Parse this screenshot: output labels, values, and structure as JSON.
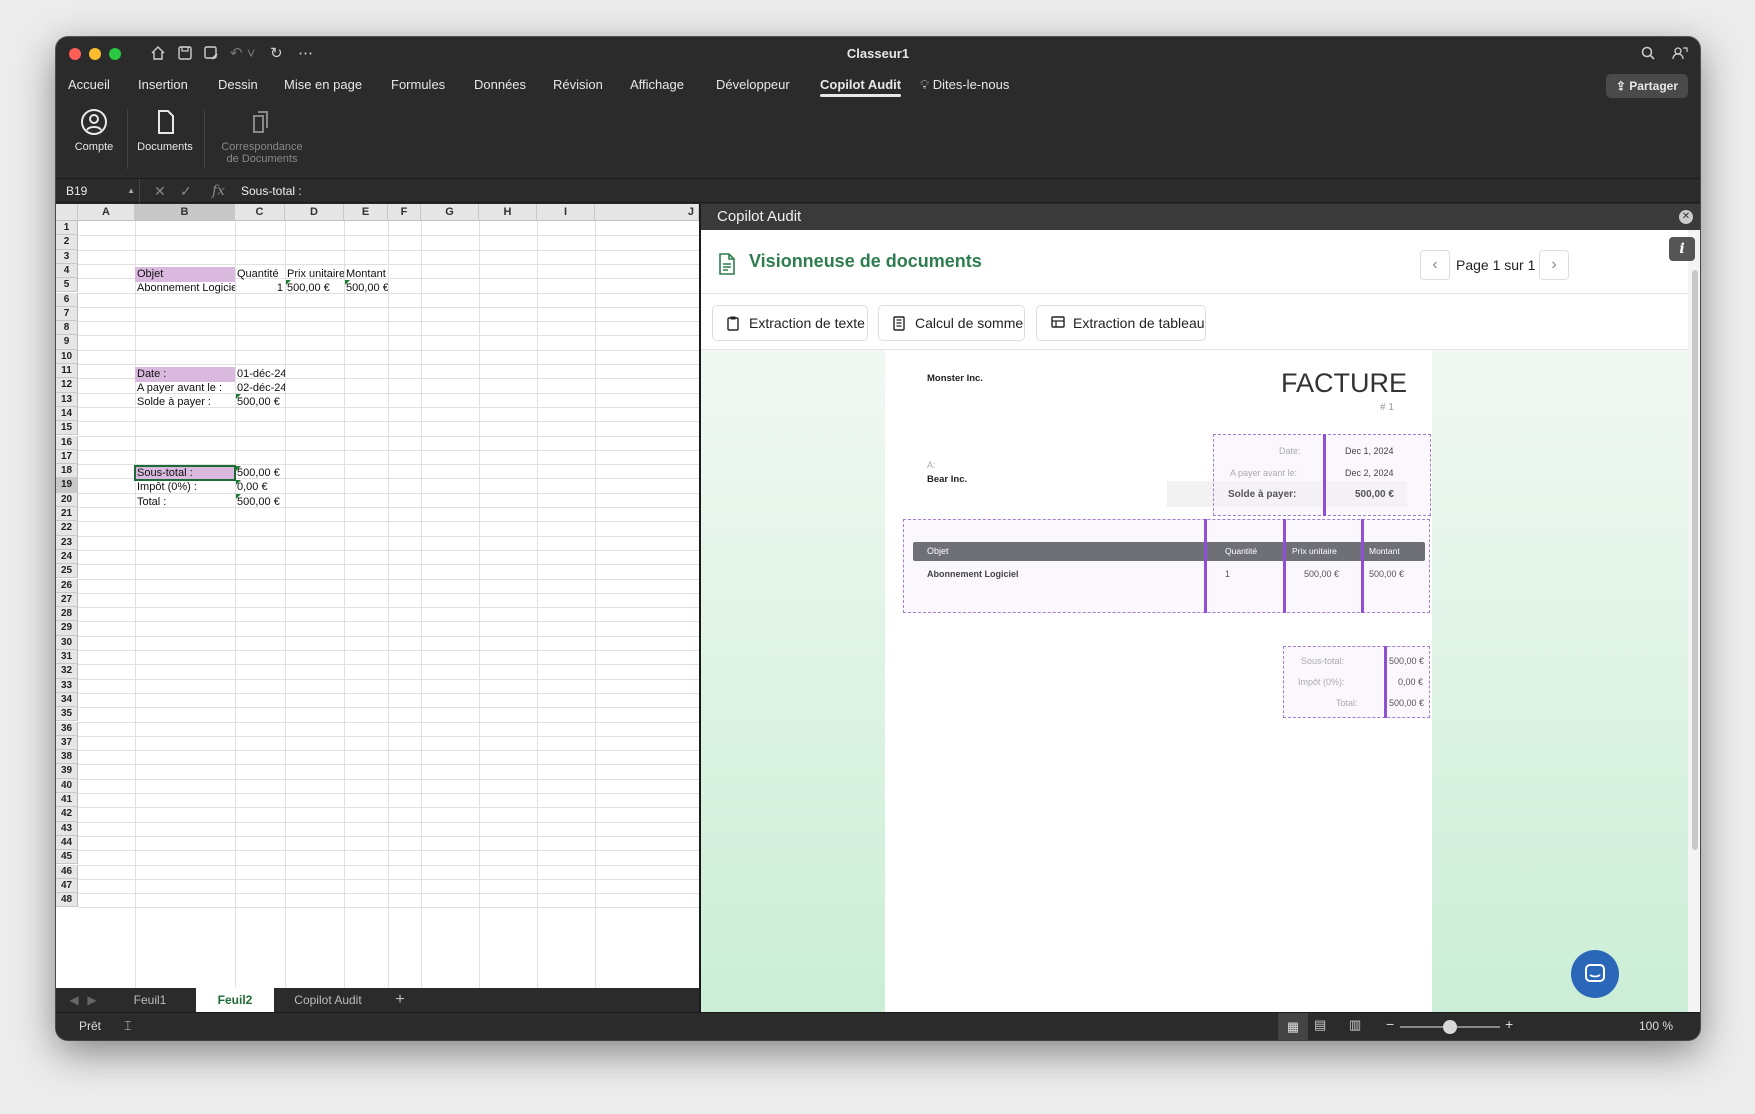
{
  "window": {
    "title": "Classeur1"
  },
  "menu_tabs": [
    "Accueil",
    "Insertion",
    "Dessin",
    "Mise en page",
    "Formules",
    "Données",
    "Révision",
    "Affichage",
    "Développeur",
    "Copilot Audit"
  ],
  "active_tab": "Copilot Audit",
  "tell_me": "Dites-le-nous",
  "share_label": "Partager",
  "ribbon": {
    "compte": "Compte",
    "documents": "Documents",
    "correspondance_l1": "Correspondance",
    "correspondance_l2": "de Documents"
  },
  "formula_bar": {
    "cell_ref": "B19",
    "fx": "fx",
    "content": "Sous-total :"
  },
  "columns": [
    "A",
    "B",
    "C",
    "D",
    "E",
    "F",
    "G",
    "H",
    "I",
    "J"
  ],
  "cells": {
    "b5": "Objet",
    "c5": "Quantité",
    "d5": "Prix unitaire",
    "e5": "Montant",
    "b6": "Abonnement Logiciel",
    "c6": "1",
    "d6": "500,00 €",
    "e6": "500,00 €",
    "b12": "Date :",
    "c12": "01-déc-24",
    "b13": "A payer avant le :",
    "c13": "02-déc-24",
    "b14": "Solde à payer :",
    "c14": "500,00 €",
    "b19": "Sous-total :",
    "c19": "500,00 €",
    "b20": "Impôt (0%) :",
    "c20": "0,00 €",
    "b21": "Total :",
    "c21": "500,00 €"
  },
  "sheet_tabs": [
    "Feuil1",
    "Feuil2",
    "Copilot Audit"
  ],
  "active_sheet": "Feuil2",
  "status": {
    "ready": "Prêt",
    "zoom": "100 %"
  },
  "pane": {
    "title": "Copilot Audit"
  },
  "viewer": {
    "title": "Visionneuse de documents",
    "page": "Page 1 sur 1",
    "tools": [
      "Extraction de texte",
      "Calcul de somme",
      "Extraction de tableau"
    ]
  },
  "invoice": {
    "company": "Monster Inc.",
    "heading": "FACTURE",
    "number": "# 1",
    "to_label": "A:",
    "to_name": "Bear Inc.",
    "date_label": "Date:",
    "date_value": "Dec 1, 2024",
    "due_label": "A payer avant le:",
    "due_value": "Dec 2, 2024",
    "balance_label": "Solde à payer:",
    "balance_value": "500,00 €",
    "table_headers": [
      "Objet",
      "Quantité",
      "Prix unitaire",
      "Montant"
    ],
    "row": [
      "Abonnement Logiciel",
      "1",
      "500,00 €",
      "500,00 €"
    ],
    "subtotal_label": "Sous-total:",
    "subtotal_value": "500,00 €",
    "tax_label": "Impôt (0%):",
    "tax_value": "0,00 €",
    "total_label": "Total:",
    "total_value": "500,00 €"
  },
  "colors": {
    "accent_green": "#2e7d4f",
    "highlight_purple": "#8f4fd6",
    "cell_pink": "#d9b9de"
  }
}
